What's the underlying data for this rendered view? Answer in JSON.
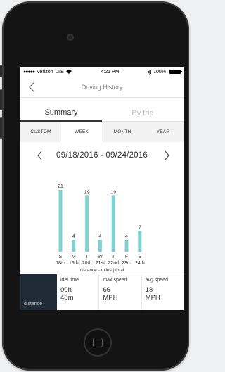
{
  "status_bar": {
    "carrier": "Verizon",
    "network": "LTE",
    "time": "4:21 PM",
    "battery": "100%"
  },
  "nav": {
    "title": "Driving History",
    "back_icon": "chevron-left-icon"
  },
  "segment_tabs": [
    {
      "label": "Summary",
      "active": true
    },
    {
      "label": "By trip",
      "active": false
    }
  ],
  "range_tabs": [
    {
      "label": "CUSTOM",
      "active": false
    },
    {
      "label": "WEEK",
      "active": true
    },
    {
      "label": "MONTH",
      "active": false
    },
    {
      "label": "YEAR",
      "active": false
    }
  ],
  "date_range": "09/18/2016 - 09/24/2016",
  "chart_data": {
    "type": "bar",
    "categories": [
      "S",
      "M",
      "T",
      "W",
      "T",
      "F",
      "S"
    ],
    "dates": [
      "18th",
      "19th",
      "20th",
      "21st",
      "22nd",
      "23rd",
      "24th"
    ],
    "values": [
      21,
      4,
      19,
      4,
      19,
      4,
      7
    ],
    "caption": "distance - miles | total",
    "bar_color": "#7fd1d1",
    "ylim": [
      0,
      21
    ]
  },
  "stats": {
    "selected": "distance",
    "items": [
      {
        "label": "idel time",
        "value1": "00h",
        "value2": "48m"
      },
      {
        "label": "max speed",
        "value1": "66",
        "value2": "MPH"
      },
      {
        "label": "avg speed",
        "value1": "18",
        "value2": "MPH"
      }
    ]
  }
}
